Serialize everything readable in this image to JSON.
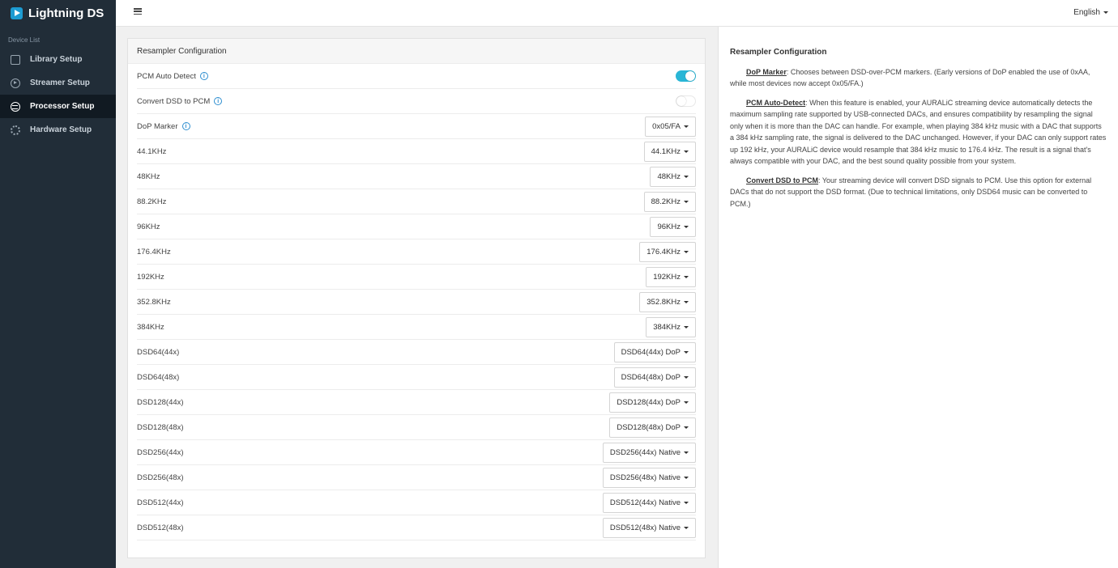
{
  "app": {
    "name": "Lightning DS"
  },
  "sidebar": {
    "heading": "Device List",
    "items": [
      {
        "label": "Library Setup",
        "icon": "library-icon",
        "active": false
      },
      {
        "label": "Streamer Setup",
        "icon": "play-circle-icon",
        "active": false
      },
      {
        "label": "Processor Setup",
        "icon": "waveform-icon",
        "active": true
      },
      {
        "label": "Hardware Setup",
        "icon": "gear-icon",
        "active": false
      }
    ]
  },
  "topbar": {
    "language": "English",
    "menu_icon": "menu-icon"
  },
  "panel": {
    "title": "Resampler Configuration",
    "toggles": [
      {
        "label": "PCM Auto Detect",
        "on": true
      },
      {
        "label": "Convert DSD to PCM",
        "on": false
      }
    ],
    "selects": [
      {
        "label": "DoP Marker",
        "value": "0x05/FA",
        "info": true
      },
      {
        "label": "44.1KHz",
        "value": "44.1KHz"
      },
      {
        "label": "48KHz",
        "value": "48KHz"
      },
      {
        "label": "88.2KHz",
        "value": "88.2KHz"
      },
      {
        "label": "96KHz",
        "value": "96KHz"
      },
      {
        "label": "176.4KHz",
        "value": "176.4KHz"
      },
      {
        "label": "192KHz",
        "value": "192KHz"
      },
      {
        "label": "352.8KHz",
        "value": "352.8KHz"
      },
      {
        "label": "384KHz",
        "value": "384KHz"
      },
      {
        "label": "DSD64(44x)",
        "value": "DSD64(44x) DoP"
      },
      {
        "label": "DSD64(48x)",
        "value": "DSD64(48x) DoP"
      },
      {
        "label": "DSD128(44x)",
        "value": "DSD128(44x) DoP"
      },
      {
        "label": "DSD128(48x)",
        "value": "DSD128(48x) DoP"
      },
      {
        "label": "DSD256(44x)",
        "value": "DSD256(44x) Native"
      },
      {
        "label": "DSD256(48x)",
        "value": "DSD256(48x) Native"
      },
      {
        "label": "DSD512(44x)",
        "value": "DSD512(44x) Native"
      },
      {
        "label": "DSD512(48x)",
        "value": "DSD512(48x) Native"
      }
    ]
  },
  "help": {
    "title": "Resampler Configuration",
    "sections": [
      {
        "term": "DoP Marker",
        "text": ": Chooses between DSD-over-PCM markers. (Early versions of DoP enabled the use of 0xAA, while most devices now accept 0x05/FA.)"
      },
      {
        "term": "PCM Auto-Detect",
        "text": ": When this feature is enabled, your AURALiC streaming device automatically detects the maximum sampling rate supported by USB-connected DACs, and ensures compatibility by resampling the signal only when it is more than the DAC can handle. For example, when playing 384 kHz music with a DAC that supports a 384 kHz sampling rate, the signal is delivered to the DAC unchanged. However, if your DAC can only support rates up 192 kHz, your AURALiC device would resample that 384 kHz music to 176.4 kHz. The result is a signal that's always compatible with your DAC, and the best sound quality possible from your system."
      },
      {
        "term": "Convert DSD to PCM",
        "text": ": Your streaming device will convert DSD signals to PCM. Use this option for external DACs that do not support the DSD format. (Due to technical limitations, only DSD64 music can be converted to PCM.)"
      }
    ]
  },
  "colors": {
    "sidebar_bg": "#212d38",
    "accent": "#29b6d6",
    "info": "#2f8fd0"
  }
}
